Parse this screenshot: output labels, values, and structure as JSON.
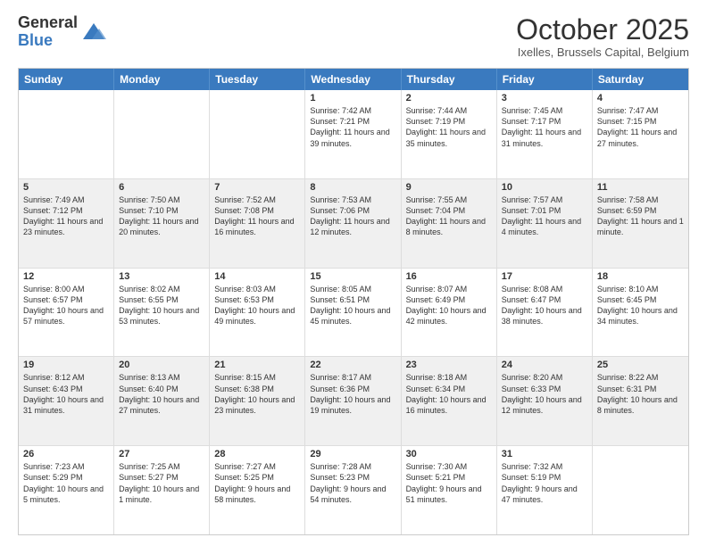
{
  "logo": {
    "general": "General",
    "blue": "Blue"
  },
  "header": {
    "month": "October 2025",
    "location": "Ixelles, Brussels Capital, Belgium"
  },
  "days": [
    "Sunday",
    "Monday",
    "Tuesday",
    "Wednesday",
    "Thursday",
    "Friday",
    "Saturday"
  ],
  "weeks": [
    [
      {
        "day": "",
        "content": ""
      },
      {
        "day": "",
        "content": ""
      },
      {
        "day": "",
        "content": ""
      },
      {
        "day": "1",
        "content": "Sunrise: 7:42 AM\nSunset: 7:21 PM\nDaylight: 11 hours\nand 39 minutes."
      },
      {
        "day": "2",
        "content": "Sunrise: 7:44 AM\nSunset: 7:19 PM\nDaylight: 11 hours\nand 35 minutes."
      },
      {
        "day": "3",
        "content": "Sunrise: 7:45 AM\nSunset: 7:17 PM\nDaylight: 11 hours\nand 31 minutes."
      },
      {
        "day": "4",
        "content": "Sunrise: 7:47 AM\nSunset: 7:15 PM\nDaylight: 11 hours\nand 27 minutes."
      }
    ],
    [
      {
        "day": "5",
        "content": "Sunrise: 7:49 AM\nSunset: 7:12 PM\nDaylight: 11 hours\nand 23 minutes."
      },
      {
        "day": "6",
        "content": "Sunrise: 7:50 AM\nSunset: 7:10 PM\nDaylight: 11 hours\nand 20 minutes."
      },
      {
        "day": "7",
        "content": "Sunrise: 7:52 AM\nSunset: 7:08 PM\nDaylight: 11 hours\nand 16 minutes."
      },
      {
        "day": "8",
        "content": "Sunrise: 7:53 AM\nSunset: 7:06 PM\nDaylight: 11 hours\nand 12 minutes."
      },
      {
        "day": "9",
        "content": "Sunrise: 7:55 AM\nSunset: 7:04 PM\nDaylight: 11 hours\nand 8 minutes."
      },
      {
        "day": "10",
        "content": "Sunrise: 7:57 AM\nSunset: 7:01 PM\nDaylight: 11 hours\nand 4 minutes."
      },
      {
        "day": "11",
        "content": "Sunrise: 7:58 AM\nSunset: 6:59 PM\nDaylight: 11 hours\nand 1 minute."
      }
    ],
    [
      {
        "day": "12",
        "content": "Sunrise: 8:00 AM\nSunset: 6:57 PM\nDaylight: 10 hours\nand 57 minutes."
      },
      {
        "day": "13",
        "content": "Sunrise: 8:02 AM\nSunset: 6:55 PM\nDaylight: 10 hours\nand 53 minutes."
      },
      {
        "day": "14",
        "content": "Sunrise: 8:03 AM\nSunset: 6:53 PM\nDaylight: 10 hours\nand 49 minutes."
      },
      {
        "day": "15",
        "content": "Sunrise: 8:05 AM\nSunset: 6:51 PM\nDaylight: 10 hours\nand 45 minutes."
      },
      {
        "day": "16",
        "content": "Sunrise: 8:07 AM\nSunset: 6:49 PM\nDaylight: 10 hours\nand 42 minutes."
      },
      {
        "day": "17",
        "content": "Sunrise: 8:08 AM\nSunset: 6:47 PM\nDaylight: 10 hours\nand 38 minutes."
      },
      {
        "day": "18",
        "content": "Sunrise: 8:10 AM\nSunset: 6:45 PM\nDaylight: 10 hours\nand 34 minutes."
      }
    ],
    [
      {
        "day": "19",
        "content": "Sunrise: 8:12 AM\nSunset: 6:43 PM\nDaylight: 10 hours\nand 31 minutes."
      },
      {
        "day": "20",
        "content": "Sunrise: 8:13 AM\nSunset: 6:40 PM\nDaylight: 10 hours\nand 27 minutes."
      },
      {
        "day": "21",
        "content": "Sunrise: 8:15 AM\nSunset: 6:38 PM\nDaylight: 10 hours\nand 23 minutes."
      },
      {
        "day": "22",
        "content": "Sunrise: 8:17 AM\nSunset: 6:36 PM\nDaylight: 10 hours\nand 19 minutes."
      },
      {
        "day": "23",
        "content": "Sunrise: 8:18 AM\nSunset: 6:34 PM\nDaylight: 10 hours\nand 16 minutes."
      },
      {
        "day": "24",
        "content": "Sunrise: 8:20 AM\nSunset: 6:33 PM\nDaylight: 10 hours\nand 12 minutes."
      },
      {
        "day": "25",
        "content": "Sunrise: 8:22 AM\nSunset: 6:31 PM\nDaylight: 10 hours\nand 8 minutes."
      }
    ],
    [
      {
        "day": "26",
        "content": "Sunrise: 7:23 AM\nSunset: 5:29 PM\nDaylight: 10 hours\nand 5 minutes."
      },
      {
        "day": "27",
        "content": "Sunrise: 7:25 AM\nSunset: 5:27 PM\nDaylight: 10 hours\nand 1 minute."
      },
      {
        "day": "28",
        "content": "Sunrise: 7:27 AM\nSunset: 5:25 PM\nDaylight: 9 hours\nand 58 minutes."
      },
      {
        "day": "29",
        "content": "Sunrise: 7:28 AM\nSunset: 5:23 PM\nDaylight: 9 hours\nand 54 minutes."
      },
      {
        "day": "30",
        "content": "Sunrise: 7:30 AM\nSunset: 5:21 PM\nDaylight: 9 hours\nand 51 minutes."
      },
      {
        "day": "31",
        "content": "Sunrise: 7:32 AM\nSunset: 5:19 PM\nDaylight: 9 hours\nand 47 minutes."
      },
      {
        "day": "",
        "content": ""
      }
    ]
  ]
}
